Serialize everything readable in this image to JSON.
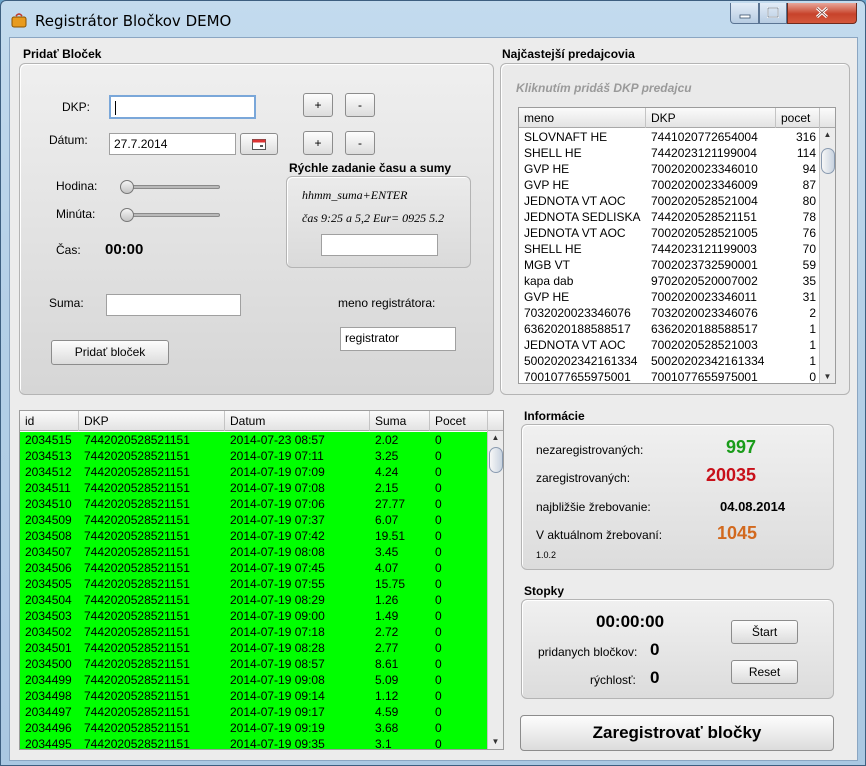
{
  "window": {
    "title": "Registrátor Bločkov DEMO"
  },
  "colors": {
    "table_row_bg": "#00ff00",
    "nezaregistrovanych": "#1a9c1a",
    "zaregistrovanych": "#c8101a",
    "aktualne": "#d2691e"
  },
  "pridat": {
    "section_title": "Pridať Bloček",
    "dkp_label": "DKP:",
    "dkp_value": "",
    "datum_label": "Dátum:",
    "datum_value": "27.7.2014",
    "plus": "+",
    "minus": "-",
    "hodina_label": "Hodina:",
    "hodina_level": 0,
    "minuta_label": "Minúta:",
    "minuta_level": 0,
    "cas_label": "Čas:",
    "cas_value": "00:00",
    "suma_label": "Suma:",
    "suma_value": "",
    "button": "Pridať bloček",
    "meno_label": "meno registrátora:",
    "meno_value": "registrator"
  },
  "rychle": {
    "title": "Rýchle zadanie času a sumy",
    "hint1": "hhmm_suma+ENTER",
    "hint2": "čas 9:25 a 5,2 Eur= 0925 5.2",
    "value": ""
  },
  "predajcovia": {
    "section_title": "Najčastejší predajcovia",
    "hint": "Kliknutím pridáš DKP predajcu",
    "columns": [
      "meno",
      "DKP",
      "pocet"
    ],
    "rows": [
      [
        "SLOVNAFT HE",
        "7441020772654004",
        "316"
      ],
      [
        "SHELL HE",
        "7442023121199004",
        "114"
      ],
      [
        "GVP HE",
        "7002020023346010",
        "94"
      ],
      [
        "GVP HE",
        "7002020023346009",
        "87"
      ],
      [
        "JEDNOTA VT AOC",
        "7002020528521004",
        "80"
      ],
      [
        "JEDNOTA SEDLISKA",
        "7442020528521151",
        "78"
      ],
      [
        "JEDNOTA VT AOC",
        "7002020528521005",
        "76"
      ],
      [
        "SHELL HE",
        "7442023121199003",
        "70"
      ],
      [
        "MGB VT",
        "7002023732590001",
        "59"
      ],
      [
        "kapa dab",
        "9702020520007002",
        "35"
      ],
      [
        "GVP HE",
        "7002020023346011",
        "31"
      ],
      [
        "7032020023346076",
        "7032020023346076",
        "2"
      ],
      [
        "6362020188588517",
        "6362020188588517",
        "1"
      ],
      [
        "JEDNOTA VT AOC",
        "7002020528521003",
        "1"
      ],
      [
        "500202023421613​34",
        "5002020234216133​4",
        "1"
      ],
      [
        "7001077655975001",
        "7001077655975001",
        "0"
      ]
    ]
  },
  "blocky": {
    "columns": [
      "id",
      "DKP",
      "Datum",
      "Suma",
      "Pocet"
    ],
    "rows": [
      [
        "2034515",
        "7442020528521151",
        "2014-07-23 08:57",
        "2.02",
        "0"
      ],
      [
        "2034513",
        "7442020528521151",
        "2014-07-19 07:11",
        "3.25",
        "0"
      ],
      [
        "2034512",
        "7442020528521151",
        "2014-07-19 07:09",
        "4.24",
        "0"
      ],
      [
        "2034511",
        "7442020528521151",
        "2014-07-19 07:08",
        "2.15",
        "0"
      ],
      [
        "2034510",
        "7442020528521151",
        "2014-07-19 07:06",
        "27.77",
        "0"
      ],
      [
        "2034509",
        "7442020528521151",
        "2014-07-19 07:37",
        "6.07",
        "0"
      ],
      [
        "2034508",
        "7442020528521151",
        "2014-07-19 07:42",
        "19.51",
        "0"
      ],
      [
        "2034507",
        "7442020528521151",
        "2014-07-19 08:08",
        "3.45",
        "0"
      ],
      [
        "2034506",
        "7442020528521151",
        "2014-07-19 07:45",
        "4.07",
        "0"
      ],
      [
        "2034505",
        "7442020528521151",
        "2014-07-19 07:55",
        "15.75",
        "0"
      ],
      [
        "2034504",
        "7442020528521151",
        "2014-07-19 08:29",
        "1.26",
        "0"
      ],
      [
        "2034503",
        "7442020528521151",
        "2014-07-19 09:00",
        "1.49",
        "0"
      ],
      [
        "2034502",
        "7442020528521151",
        "2014-07-19 07:18",
        "2.72",
        "0"
      ],
      [
        "2034501",
        "7442020528521151",
        "2014-07-19 08:28",
        "2.77",
        "0"
      ],
      [
        "2034500",
        "7442020528521151",
        "2014-07-19 08:57",
        "8.61",
        "0"
      ],
      [
        "2034499",
        "7442020528521151",
        "2014-07-19 09:08",
        "5.09",
        "0"
      ],
      [
        "2034498",
        "7442020528521151",
        "2014-07-19 09:14",
        "1.12",
        "0"
      ],
      [
        "2034497",
        "7442020528521151",
        "2014-07-19 09:17",
        "4.59",
        "0"
      ],
      [
        "2034496",
        "7442020528521151",
        "2014-07-19 09:19",
        "3.68",
        "0"
      ],
      [
        "2034495",
        "7442020528521151",
        "2014-07-19 09:35",
        "3.1",
        "0"
      ]
    ]
  },
  "informacie": {
    "section_title": "Informácie",
    "nezaregistrovanych_label": "nezaregistrovaných:",
    "nezaregistrovanych_value": "997",
    "zaregistrovanych_label": "zaregistrovaných:",
    "zaregistrovanych_value": "20035",
    "najblizsie_label": "najbližšie žrebovanie:",
    "najblizsie_value": "04.08.2014",
    "aktualne_label": "V aktuálnom žrebovaní:",
    "aktualne_value": "1045",
    "version": "1.0.2"
  },
  "stopky": {
    "section_title": "Stopky",
    "time": "00:00:00",
    "pridanych_label": "pridanych bločkov:",
    "pridanych_value": "0",
    "rychlost_label": "rýchlosť:",
    "rychlost_value": "0",
    "start": "Štart",
    "reset": "Reset"
  },
  "zaregistrovat": "Zaregistrovať bločky"
}
